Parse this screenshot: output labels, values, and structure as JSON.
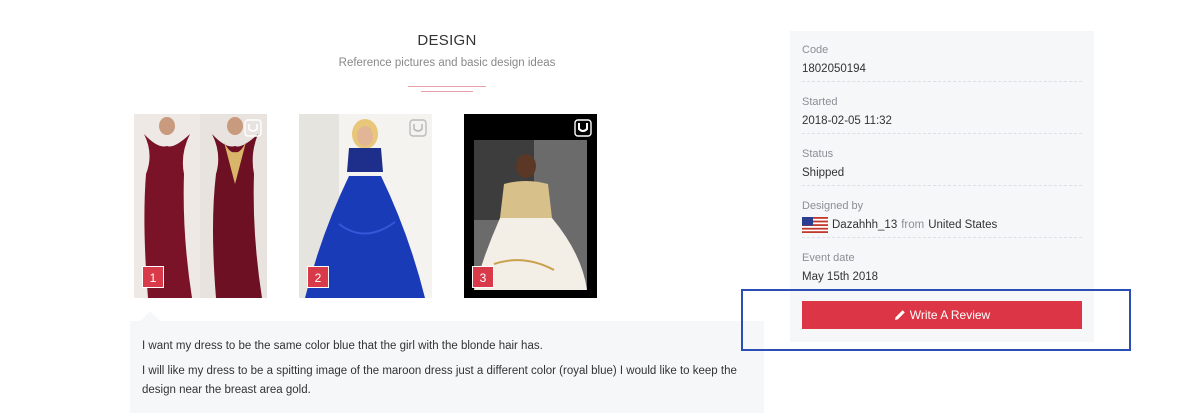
{
  "design": {
    "title": "DESIGN",
    "subtitle": "Reference pictures and basic design ideas"
  },
  "thumbnails": [
    {
      "number": "1",
      "colors": {
        "dress": "#7a1328",
        "gold": "#d9b56a"
      }
    },
    {
      "number": "2",
      "colors": {
        "dress": "#1a3bb8",
        "top": "#1d2f8a"
      }
    },
    {
      "number": "3",
      "colors": {
        "dress": "#f3efe6",
        "gold": "#c9a04c"
      }
    }
  ],
  "comments": [
    "I want my dress to be the same color blue that the girl with the blonde hair has.",
    "I will like my dress to be a spitting image of the maroon dress just a different color (royal blue) I would like to keep the design near the breast area gold."
  ],
  "info": {
    "code_label": "Code",
    "code_value": "1802050194",
    "started_label": "Started",
    "started_value": "2018-02-05 11:32",
    "status_label": "Status",
    "status_value": "Shipped",
    "designer_label": "Designed by",
    "designer_name": "Dazahhh_13",
    "designer_from": "from",
    "designer_country": "United States",
    "event_label": "Event date",
    "event_value": "May 15th 2018"
  },
  "review_button": {
    "label": "Write A Review",
    "icon": "pencil-icon",
    "color": "#dc3545"
  },
  "highlight_color": "#2b4eb5"
}
